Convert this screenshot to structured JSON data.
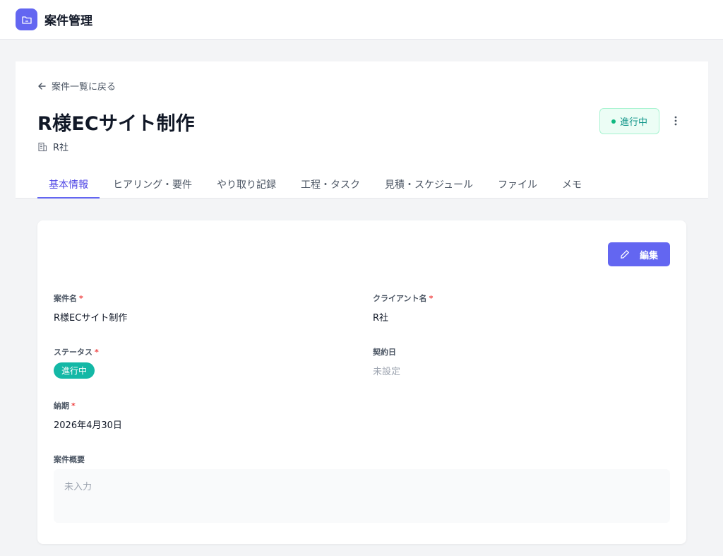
{
  "app": {
    "title": "案件管理",
    "icon": "folder-icon",
    "accent": "#6366f1"
  },
  "header": {
    "back_label": "案件一覧に戻る",
    "project_title": "R様ECサイト制作",
    "client": "R社",
    "status": "進行中",
    "status_color": "#10b981"
  },
  "tabs": [
    {
      "label": "基本情報",
      "active": true
    },
    {
      "label": "ヒアリング・要件",
      "active": false
    },
    {
      "label": "やり取り記録",
      "active": false
    },
    {
      "label": "工程・タスク",
      "active": false
    },
    {
      "label": "見積・スケジュール",
      "active": false
    },
    {
      "label": "ファイル",
      "active": false
    },
    {
      "label": "メモ",
      "active": false
    }
  ],
  "detail": {
    "edit_label": "編集",
    "fields": {
      "project_name": {
        "label": "案件名",
        "required_mark": "*",
        "value": "R様ECサイト制作"
      },
      "client_name": {
        "label": "クライアント名",
        "required_mark": "*",
        "value": "R社"
      },
      "status": {
        "label": "ステータス",
        "required_mark": "*",
        "value": "進行中"
      },
      "contract_date": {
        "label": "契約日",
        "value": "未設定"
      },
      "due_date": {
        "label": "納期",
        "required_mark": "*",
        "value": "2026年4月30日"
      },
      "summary": {
        "label": "案件概要",
        "value": "未入力"
      }
    }
  }
}
